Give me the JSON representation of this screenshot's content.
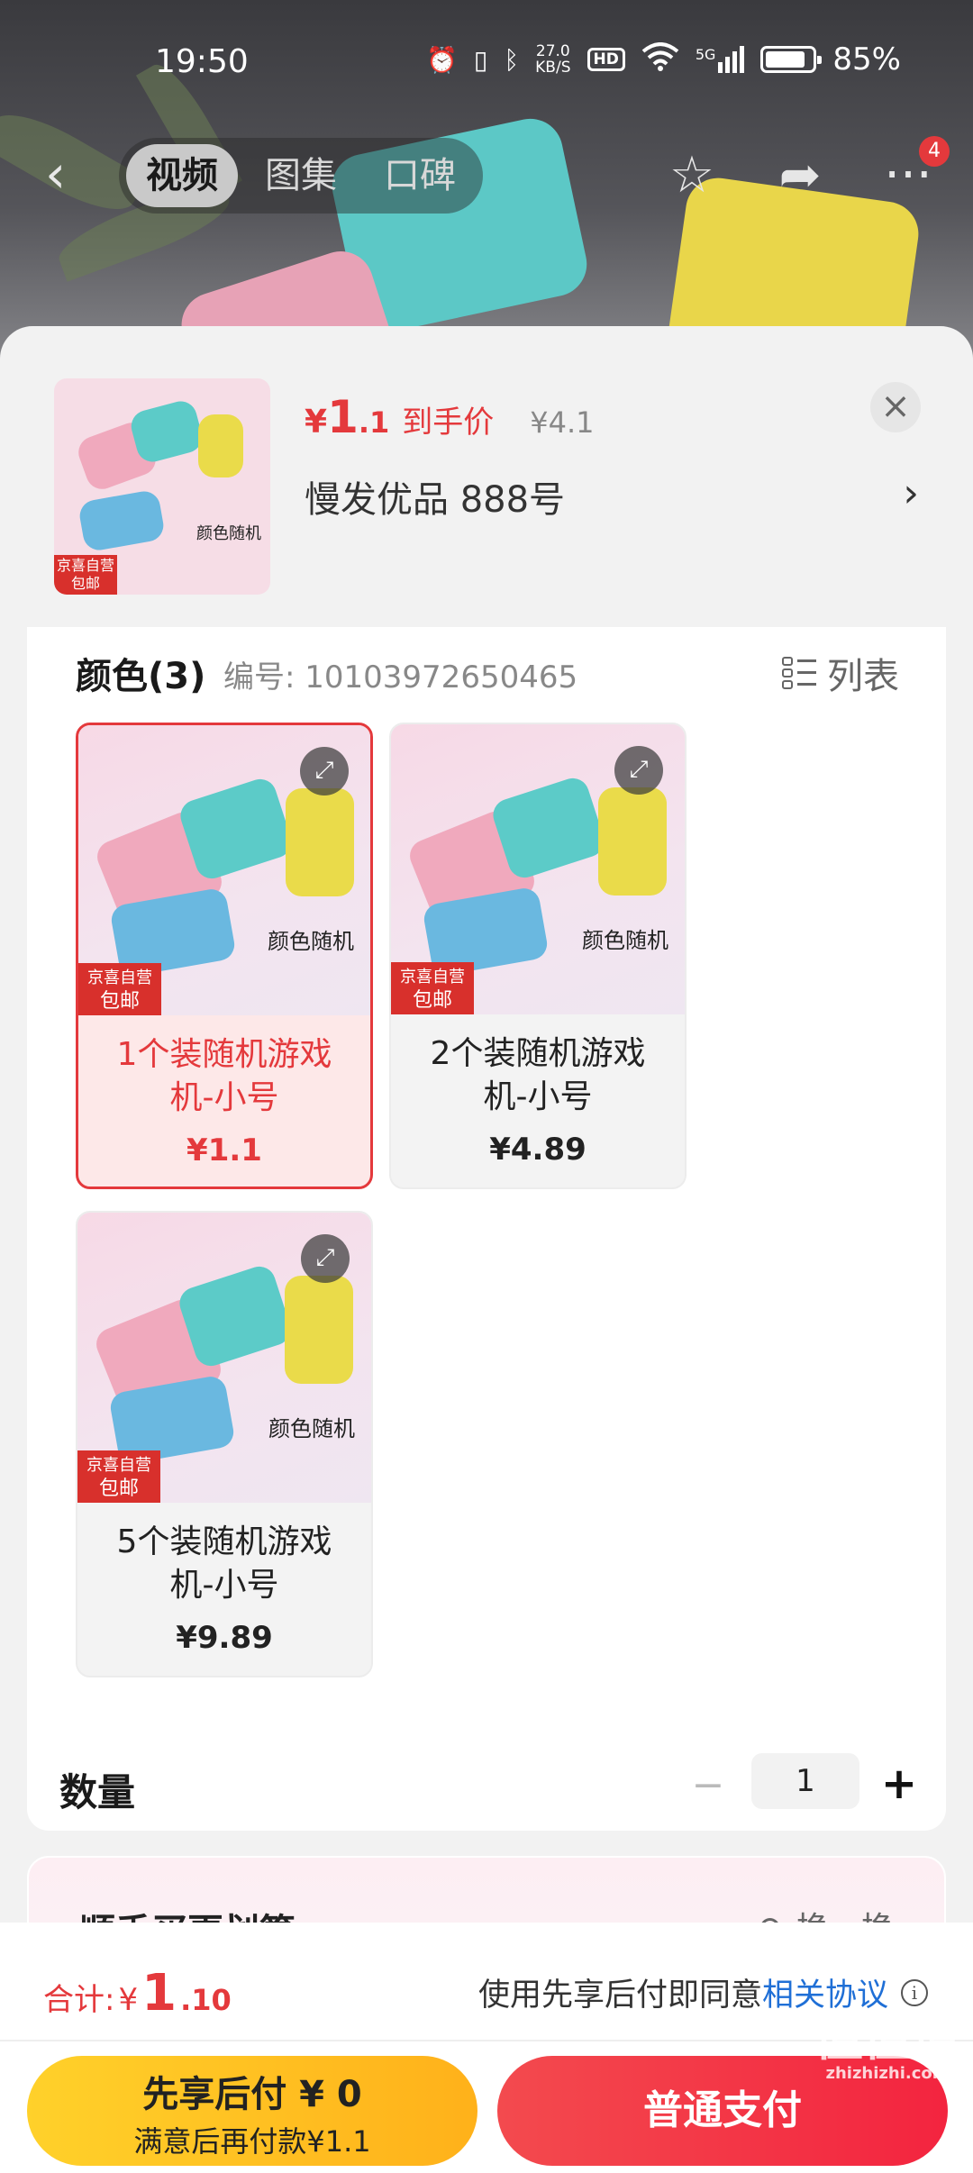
{
  "status_bar": {
    "time": "19:50",
    "net_speed_value": "27.0",
    "net_speed_unit": "KB/S",
    "hd": "HD",
    "signal": "5G",
    "battery_level": 0.85,
    "battery_pct": "85%"
  },
  "top_nav": {
    "tabs": [
      {
        "label": "视频"
      },
      {
        "label": "图集"
      },
      {
        "label": "口碑"
      }
    ],
    "active_tab": "视频",
    "more_badge": "4",
    "icons": [
      "back-arrow-icon",
      "star-icon",
      "share-icon",
      "more-icon"
    ]
  },
  "product": {
    "price_symbol": "¥",
    "price_int": "1",
    "price_dec": ".1",
    "price_label": "到手价",
    "orig_price": "¥4.1",
    "shipping": "慢发优品  888号",
    "thumb_tag_line1": "京喜自营",
    "thumb_tag_line2": "包邮",
    "thumb_caption": "颜色随机"
  },
  "spec": {
    "title": "颜色(3)",
    "code": "编号: 10103972650465",
    "list_toggle": "列表",
    "variants": [
      {
        "name": "1个装随机游戏机-小号",
        "price": "¥1.1",
        "selected": true,
        "tag1": "京喜自营",
        "tag2": "包邮",
        "caption": "颜色随机"
      },
      {
        "name": "2个装随机游戏机-小号",
        "price": "¥4.89",
        "selected": false,
        "tag1": "京喜自营",
        "tag2": "包邮",
        "caption": "颜色随机"
      },
      {
        "name": "5个装随机游戏机-小号",
        "price": "¥9.89",
        "selected": false,
        "tag1": "京喜自营",
        "tag2": "包邮",
        "caption": "颜色随机"
      }
    ]
  },
  "quantity": {
    "label": "数量",
    "value": "1",
    "minus": "−",
    "plus": "+"
  },
  "upsell": {
    "title": "顺手买更划算",
    "swap": "换一换"
  },
  "footer": {
    "total_label": "合计: ",
    "total_symbol": "¥",
    "total_int": "1",
    "total_dec": ".10",
    "agree_text": "使用先享后付即同意",
    "agree_link": "相关协议",
    "paylater_line1": "先享后付 ¥ 0",
    "paylater_line2": "满意后再付款¥1.1",
    "normal_pay": "普通支付"
  },
  "watermark": {
    "main": "值值值",
    "sub": "zhizhizhi.com"
  },
  "colors": {
    "accent": "#e4393c",
    "link": "#1f6fd6",
    "paylater": "#ffc21f",
    "pay": "#f3303f"
  }
}
